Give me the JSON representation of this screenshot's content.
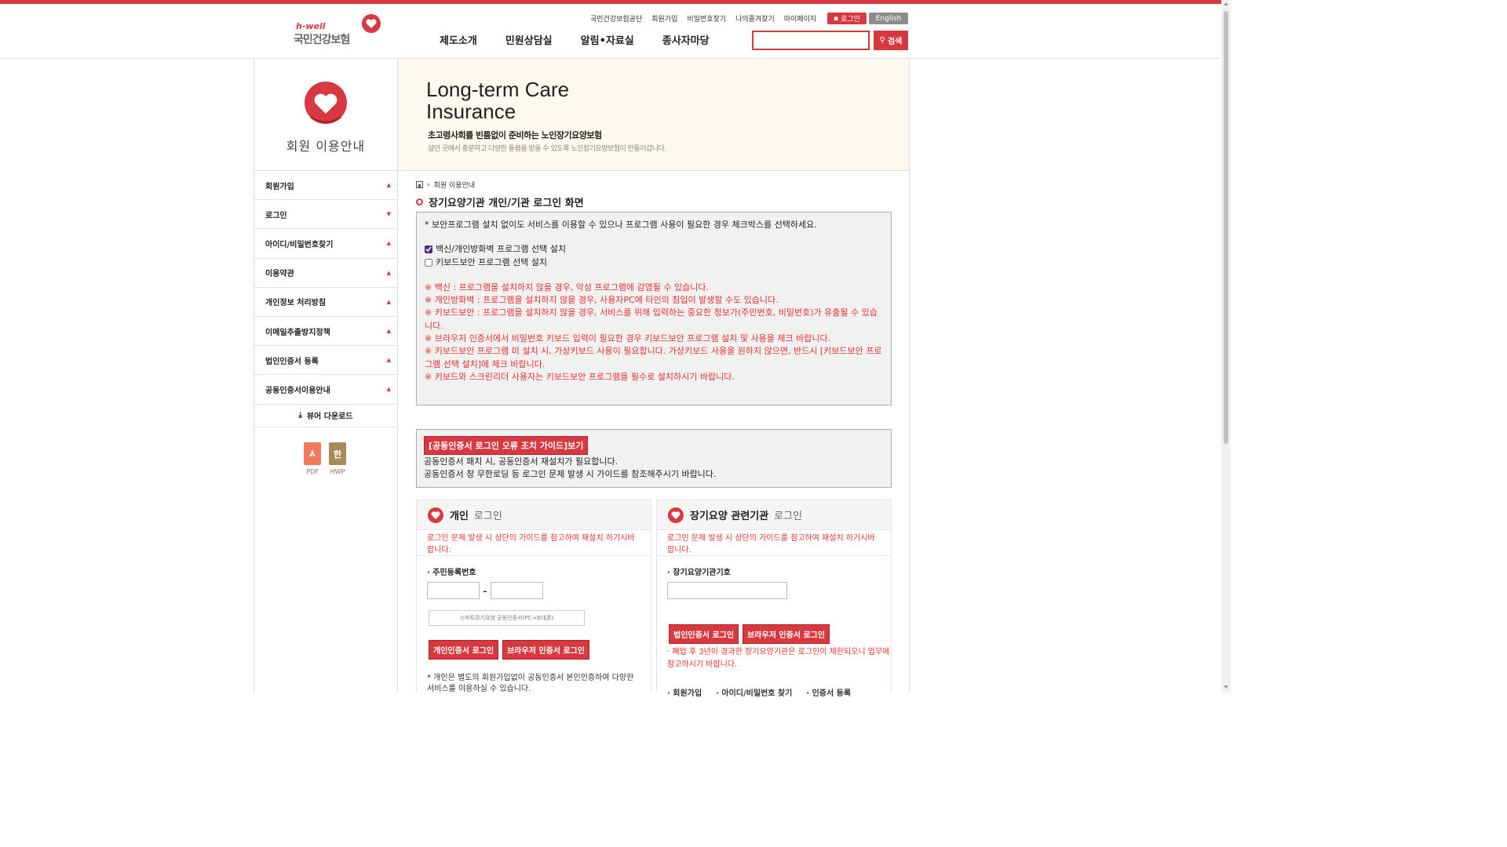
{
  "header": {
    "logo_small": "h-well",
    "logo_main": "국민건강보험",
    "util_links": [
      "국민건강보험공단",
      "회원가입",
      "비밀번호찾기",
      "나의즐겨찾기",
      "마이페이지"
    ],
    "login_label": "로그인",
    "english_label": "English",
    "gnb": [
      "제도소개",
      "민원상담실",
      "알림•자료실",
      "종사자마당"
    ],
    "search_placeholder": "",
    "search_label": "검색"
  },
  "lnb": {
    "title": "회원 이용안내",
    "items": [
      {
        "label": "회원가입",
        "arrow": "▲"
      },
      {
        "label": "로그인",
        "arrow": "▼"
      },
      {
        "label": "아이디/비밀번호찾기",
        "arrow": "▲"
      },
      {
        "label": "이용약관",
        "arrow": "▲"
      },
      {
        "label": "개인정보 처리방침",
        "arrow": "▲"
      },
      {
        "label": "이메일추출방지정책",
        "arrow": "▲"
      },
      {
        "label": "법인인증서 등록",
        "arrow": "▲"
      },
      {
        "label": "공동인증서이용안내",
        "arrow": "▲"
      }
    ],
    "viewer_label": "뷰어 다운로드",
    "docs": [
      {
        "icon": "PDF-icon",
        "glyph": "⅄",
        "label": "PDF"
      },
      {
        "icon": "hwp-icon",
        "glyph": "한",
        "label": "HWP"
      }
    ]
  },
  "visual": {
    "title_line1": "Long-term Care",
    "title_line2": "Insurance",
    "subtitle": "초고령사회를 빈틈없이 준비하는 노인장기요양보험",
    "desc": "살던 곳에서 충분하고 다양한 돌봄을 받을 수 있도록 노인장기요양보험이 만들어갑니다."
  },
  "breadcrumb": {
    "current": "회원 이용안내"
  },
  "page_title": "장기요양기관 개인/기관 로그인 화면",
  "notice": {
    "intro": "* 보안프로그램 설치 없이도 서비스를 이용할 수 있으나 프로그램 사용이 필요한 경우 체크박스를 선택하세요.",
    "checks": [
      {
        "label": "백신/개인방화벽 프로그램 선택 설치",
        "checked": true
      },
      {
        "label": "키보드보안 프로그램 선택 설치",
        "checked": false
      }
    ],
    "warnings": [
      "※ 백신 : 프로그램을 설치하지 않을 경우, 악성 프로그램에 감염될 수 있습니다.",
      "※ 개인방화벽 : 프로그램을 설치하지 않을 경우, 사용자PC에 타인의 침입이 발생할 수도 있습니다.",
      "※ 키보드보안 : 프로그램을 설치하지 않을 경우, 서비스를 위해 입력하는 중요한 정보가(주민번호, 비밀번호)가 유출될 수 있습니다.",
      "※ 브라우저 인증서에서 비밀번호 키보드 입력이 필요한 경우 키보드보안 프로그램 설치 및 사용을 체크 바랍니다.",
      "※ 키보드보안 프로그램 미 설치 시, 가상키보드 사용이 필요합니다. 가상키보드 사용을 원하지 않으면, 반드시 [키보드보안 프로그램 선택 설치]에 체크 바랍니다.",
      "※ 키보드와 스크린리더 사용자는 키보드보안 프로그램을 필수로 설치하시기 바랍니다."
    ]
  },
  "guide": {
    "button": "[공동인증서 로그인 오류 조치 가이드]보기",
    "line1": "공동인증서 패치 시, 공동인증서 재설치가 필요합니다.",
    "line2": "공동인증서 창 무한로딩 등 로그인 문제 발생 시 가이드를 참조해주시기 바랍니다."
  },
  "personal": {
    "title_strong": "개인",
    "title_light": "로그인",
    "note": "로그인 문제 발생 시 상단의 가이드를 참고하여 재설치 하기시바랍니다.",
    "field_label": "· 주민등록번호",
    "dash": "-",
    "smart_label": "스마트장기요양 공동인증서(PC→휴대폰)",
    "btn_cert": "개인인증서 로그인",
    "btn_browser": "브라우저 인증서 로그인",
    "foot": "* 개인은 별도의 회원가입없이 공동인증서 본인인증하여 다양한 서비스를 이용하실 수 있습니다."
  },
  "institution": {
    "title_strong": "장기요양 관련기관",
    "title_light": "로그인",
    "note": "로그인 문제 발생 시 상단의 가이드를 참고하여 재설치 하기시바랍니다.",
    "field_label": "· 장기요양기관기호",
    "btn_cert": "법인인증서 로그인",
    "btn_browser": "브라우저 인증서 로그인",
    "close_note": "· 폐업 후 3년이 경과한 장기요양기관은 로그인이 제한되오니 업무에 참고하시기 바랍니다.",
    "links": [
      "· 회원가입",
      "· 아이디/비밀번호 찾기",
      "· 인증서 등록"
    ]
  },
  "colors": {
    "accent": "#d8383f",
    "warning_text": "#e8302f",
    "eng_button": "#8c8c8c"
  }
}
